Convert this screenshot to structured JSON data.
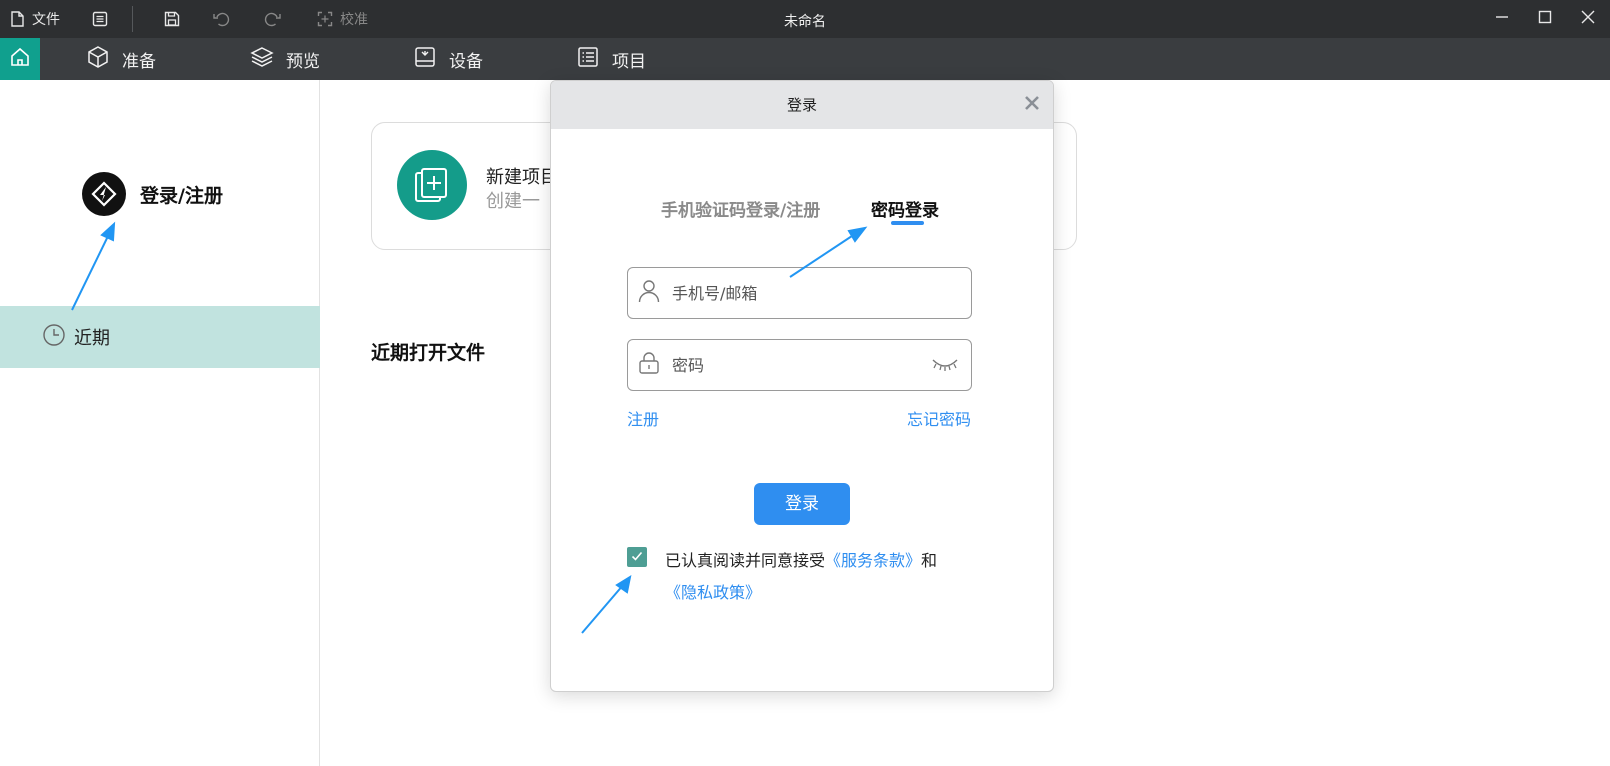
{
  "titlebar": {
    "file_label": "文件",
    "calibrate_label": "校准",
    "window_title": "未命名"
  },
  "nav": {
    "items": [
      {
        "label": "准备",
        "icon": "cube-icon"
      },
      {
        "label": "预览",
        "icon": "layers-icon"
      },
      {
        "label": "设备",
        "icon": "device-icon"
      },
      {
        "label": "项目",
        "icon": "list-icon"
      }
    ]
  },
  "sidebar": {
    "login_label": "登录/注册",
    "recent_label": "近期"
  },
  "main": {
    "new_project_title": "新建项目",
    "new_project_sub": "创建一",
    "recent_files_title": "近期打开文件"
  },
  "dialog": {
    "title": "登录",
    "tab_sms": "手机验证码登录/注册",
    "tab_password": "密码登录",
    "phone_placeholder": "手机号/邮箱",
    "password_placeholder": "密码",
    "register_link": "注册",
    "forgot_link": "忘记密码",
    "login_button": "登录",
    "agree_prefix": "已认真阅读并同意接受",
    "terms_link": "《服务条款》",
    "agree_and": "和",
    "privacy_link": "《隐私政策》",
    "agree_checked": true
  },
  "colors": {
    "accent": "#2f8ef0",
    "brand_teal": "#10a08e",
    "recent_highlight": "#c1e3df",
    "annotation_arrow": "#2196f3"
  }
}
